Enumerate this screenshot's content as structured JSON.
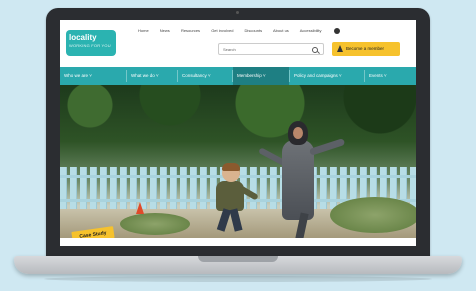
{
  "site": {
    "logo": {
      "name": "locality",
      "tagline": "WORKING FOR YOU"
    },
    "top_links": [
      "Home",
      "News",
      "Resources",
      "Get involved",
      "Discounts",
      "About us",
      "Accessibility"
    ],
    "search": {
      "placeholder": "Search"
    },
    "cta_button": "Become a member",
    "nav": [
      "Who we are",
      "What we do",
      "Consultancy",
      "Membership",
      "Policy and campaigns",
      "Events"
    ],
    "active_nav": "Membership",
    "hero_badge": "Case Study",
    "colors": {
      "teal": "#2aa9ad",
      "teal_dark": "#1e7f83",
      "cta_yellow": "#f6c22d",
      "background": "#cfe8f2"
    }
  }
}
